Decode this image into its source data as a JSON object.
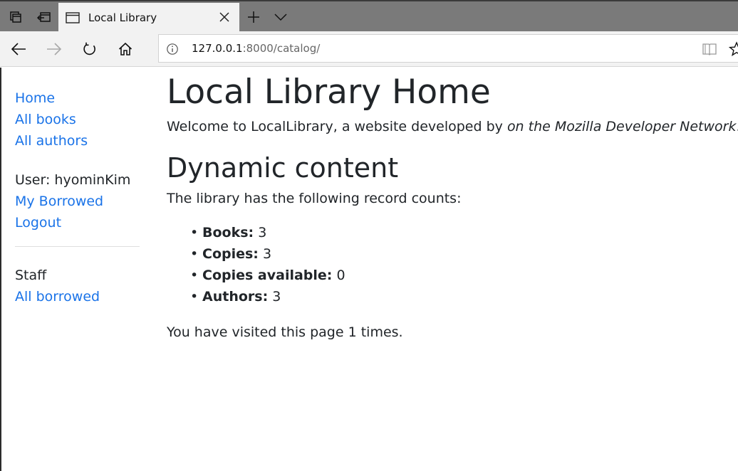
{
  "tabstrip": {
    "tab_title": "Local Library"
  },
  "toolbar": {
    "url_host": "127.0.0.1",
    "url_rest": ":8000/catalog/"
  },
  "sidebar": {
    "links": [
      "Home",
      "All books",
      "All authors"
    ],
    "user_label": "User: hyominKim",
    "my_borrowed": "My Borrowed",
    "logout": "Logout",
    "staff_label": "Staff",
    "all_borrowed": "All borrowed"
  },
  "main": {
    "title": "Local Library Home",
    "welcome_prefix": "Welcome to LocalLibrary, a website developed by ",
    "welcome_em": "on the Mozilla Developer Network",
    "welcome_suffix": ".",
    "subtitle": "Dynamic content",
    "counts_intro": "The library has the following record counts:",
    "bullet": "•",
    "counts": [
      {
        "label": "Books:",
        "value": "3"
      },
      {
        "label": "Copies:",
        "value": "3"
      },
      {
        "label": "Copies available:",
        "value": "0"
      },
      {
        "label": "Authors:",
        "value": "3"
      }
    ],
    "visits": "You have visited this page 1 times."
  },
  "icons": {
    "tab_actions": "tab-actions-icon",
    "set_aside": "set-aside-tabs-icon",
    "tab_page": "page-icon",
    "close": "close-icon",
    "new_tab": "plus-icon",
    "tab_list": "chevron-down-icon",
    "back": "arrow-left-icon",
    "forward": "arrow-right-icon",
    "refresh": "refresh-icon",
    "home": "home-icon",
    "info": "info-icon",
    "reading_view": "book-icon",
    "favorite": "star-icon"
  },
  "colors": {
    "link": "#1a73e8",
    "tabstrip": "#7a7a7a",
    "toolbar": "#f2f2f2",
    "text": "#212529"
  }
}
